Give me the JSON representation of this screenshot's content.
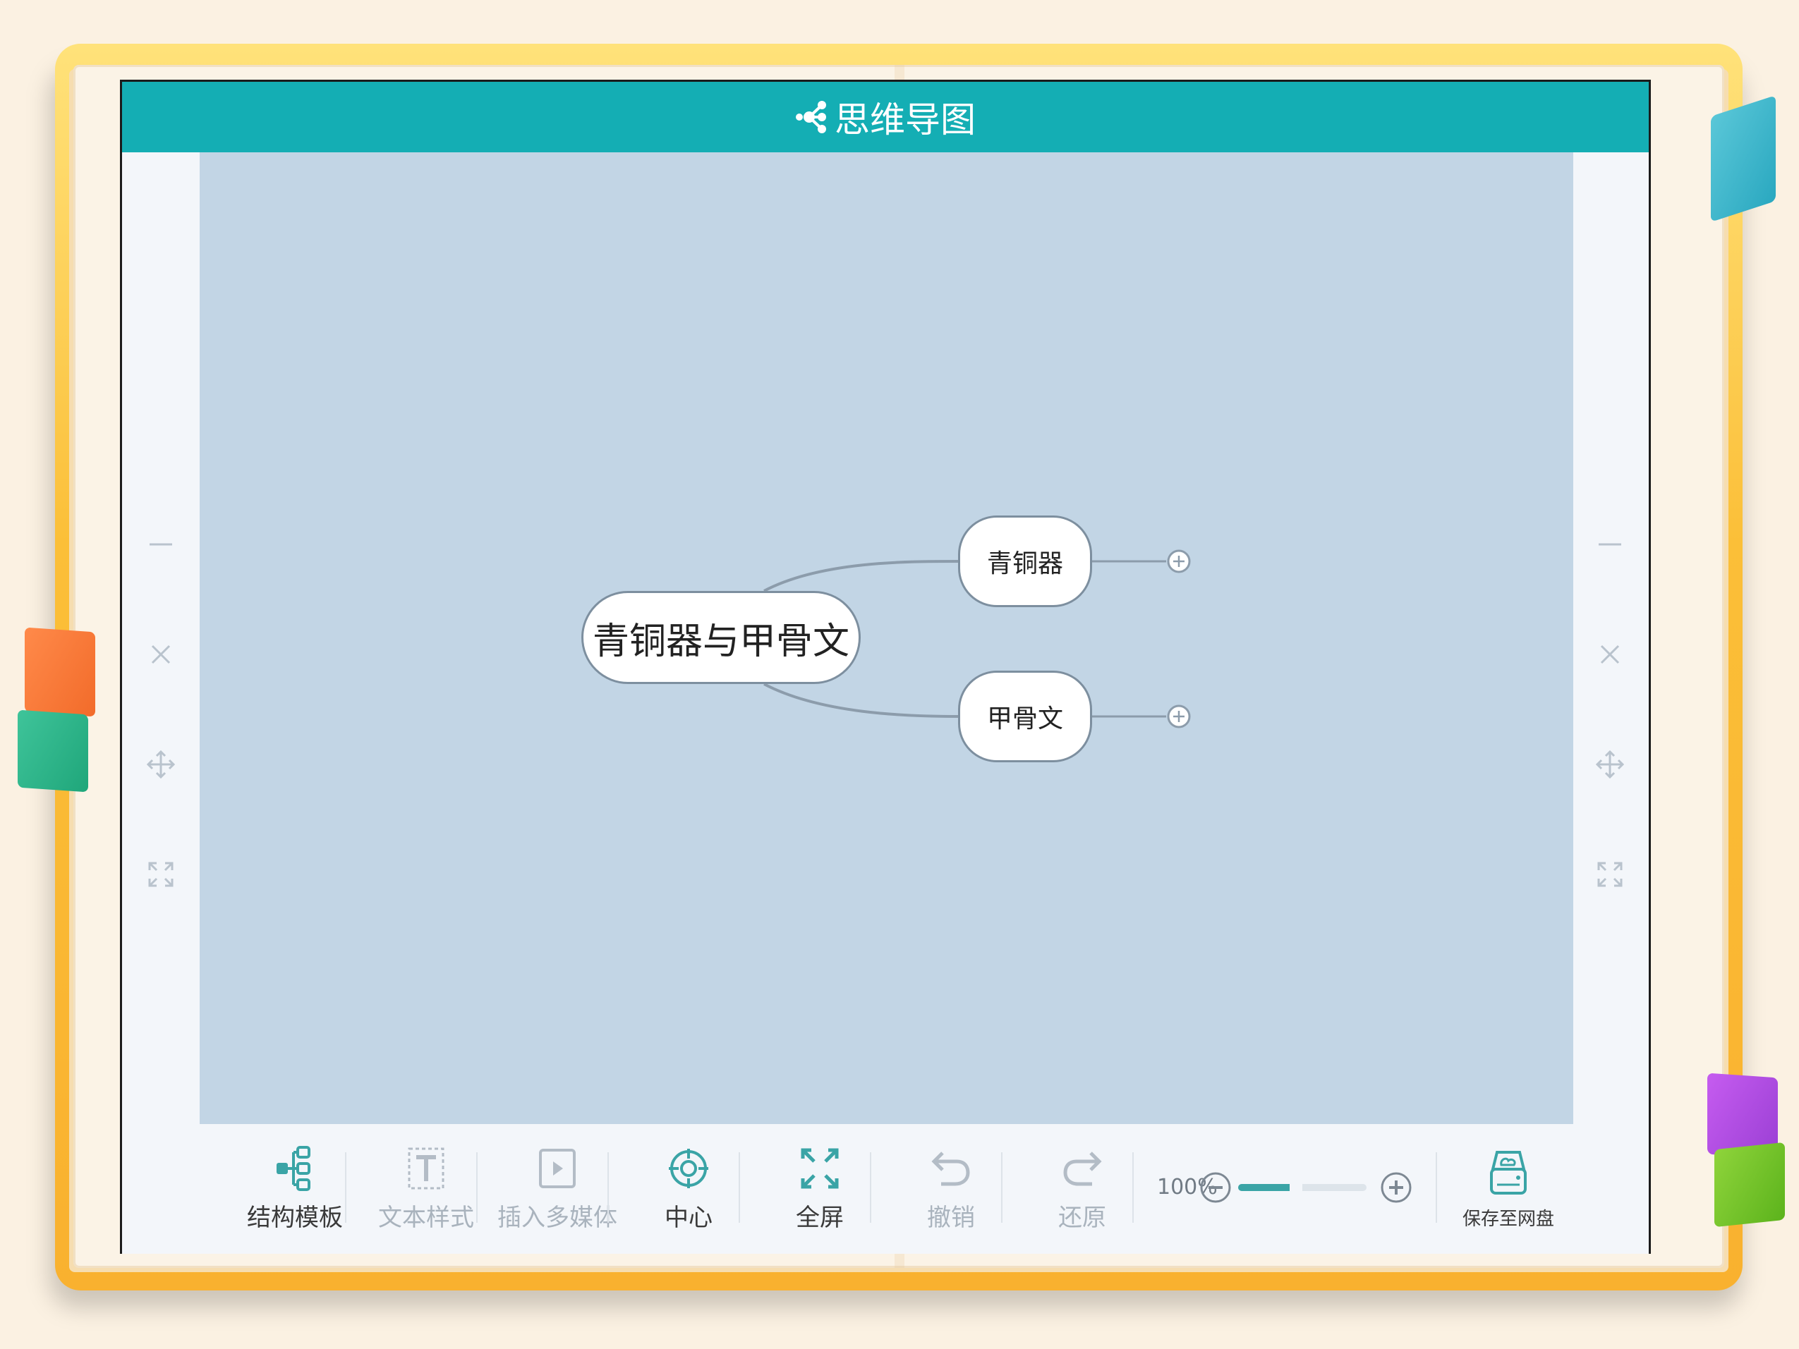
{
  "app": {
    "title": "思维导图",
    "accent_color": "#14aeb4",
    "canvas_color": "#c2d5e5"
  },
  "mindmap": {
    "root": {
      "label": "青铜器与甲骨文"
    },
    "children": [
      {
        "label": "青铜器"
      },
      {
        "label": "甲骨文"
      }
    ]
  },
  "side_controls": [
    {
      "name": "minimize",
      "icon": "minus-icon"
    },
    {
      "name": "close",
      "icon": "close-icon"
    },
    {
      "name": "move",
      "icon": "move-icon"
    },
    {
      "name": "fullscreen",
      "icon": "expand-icon"
    }
  ],
  "toolbar": {
    "structure_template": {
      "label": "结构模板",
      "icon": "structure-tree-icon",
      "enabled": true
    },
    "text_style": {
      "label": "文本样式",
      "icon": "text-style-icon",
      "enabled": false
    },
    "insert_media": {
      "label": "插入多媒体",
      "icon": "media-play-icon",
      "enabled": false
    },
    "center": {
      "label": "中心",
      "icon": "crosshair-icon",
      "enabled": true
    },
    "fullscreen": {
      "label": "全屏",
      "icon": "fullscreen-icon",
      "enabled": true
    },
    "undo": {
      "label": "撤销",
      "icon": "undo-icon",
      "enabled": false
    },
    "redo": {
      "label": "还原",
      "icon": "redo-icon",
      "enabled": false
    },
    "zoom": {
      "label": "100%",
      "level": 0.45
    },
    "save": {
      "label": "保存至网盘",
      "icon": "cloud-drive-icon",
      "enabled": true
    }
  }
}
